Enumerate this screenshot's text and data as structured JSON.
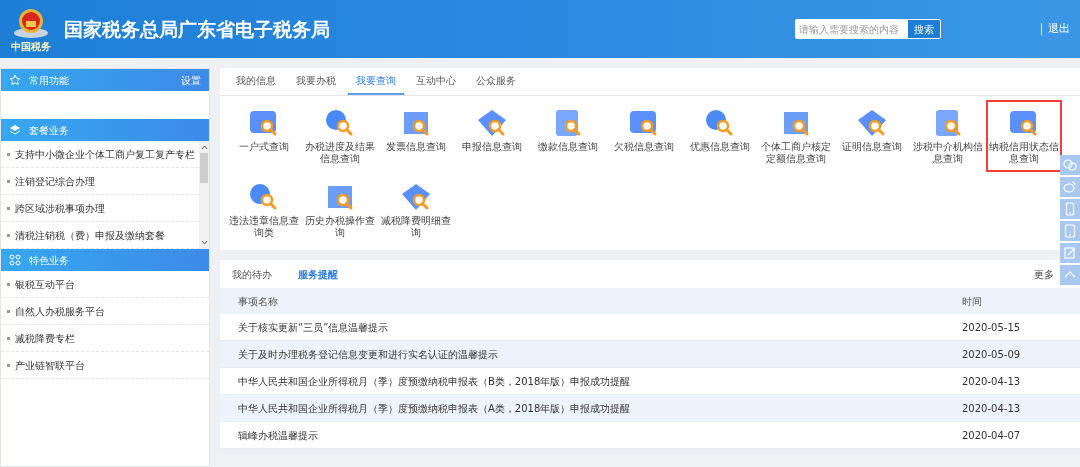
{
  "header": {
    "title": "国家税务总局广东省电子税务局",
    "logo_caption": "中国税务",
    "search": {
      "placeholder": "请输入需要搜索的内容",
      "button": "搜索"
    },
    "logout": "退出"
  },
  "sidebar": {
    "sections": [
      {
        "title": "常用功能",
        "action": "设置"
      },
      {
        "title": "套餐业务",
        "scrollable": true,
        "items": [
          "支持中小微企业个体工商户复工复产专栏",
          "注销登记综合办理",
          "跨区域涉税事项办理",
          "清税注销税（费）申报及缴纳套餐"
        ]
      },
      {
        "title": "特色业务",
        "items": [
          "银税互动平台",
          "自然人办税服务平台",
          "减税降费专栏",
          "产业链智联平台"
        ]
      }
    ]
  },
  "tabs": [
    {
      "label": "我的信息",
      "selected": false
    },
    {
      "label": "我要办税",
      "selected": false
    },
    {
      "label": "我要查询",
      "selected": true
    },
    {
      "label": "互动中心",
      "selected": false
    },
    {
      "label": "公众服务",
      "selected": false
    }
  ],
  "query_items": [
    {
      "label": "一户式查询",
      "selected": false
    },
    {
      "label": "办税进度及结果信息查询",
      "selected": false
    },
    {
      "label": "发票信息查询",
      "selected": false
    },
    {
      "label": "申报信息查询",
      "selected": false
    },
    {
      "label": "缴款信息查询",
      "selected": false
    },
    {
      "label": "欠税信息查询",
      "selected": false
    },
    {
      "label": "优惠信息查询",
      "selected": false
    },
    {
      "label": "个体工商户核定定额信息查询",
      "selected": false
    },
    {
      "label": "证明信息查询",
      "selected": false
    },
    {
      "label": "涉税中介机构信息查询",
      "selected": false
    },
    {
      "label": "纳税信用状态信息查询",
      "selected": true
    },
    {
      "label": "违法违章信息查询类",
      "selected": false
    },
    {
      "label": "历史办税操作查询",
      "selected": false
    },
    {
      "label": "减税降费明细查询",
      "selected": false
    }
  ],
  "notice_tabs": [
    {
      "label": "我的待办",
      "selected": false
    },
    {
      "label": "服务提醒",
      "selected": true
    }
  ],
  "more": "更多",
  "table": {
    "columns": [
      "事项名称",
      "时间"
    ],
    "rows": [
      [
        "关于核实更新“三员”信息温馨提示",
        "2020-05-15"
      ],
      [
        "关于及时办理税务登记信息变更和进行实名认证的温馨提示",
        "2020-05-09"
      ],
      [
        "中华人民共和国企业所得税月（季）度预缴纳税申报表（B类，2018年版）申报成功提醒",
        "2020-04-13"
      ],
      [
        "中华人民共和国企业所得税月（季）度预缴纳税申报表（A类，2018年版）申报成功提醒",
        "2020-04-13"
      ],
      [
        "辑峰办税温馨提示",
        "2020-04-07"
      ]
    ]
  }
}
